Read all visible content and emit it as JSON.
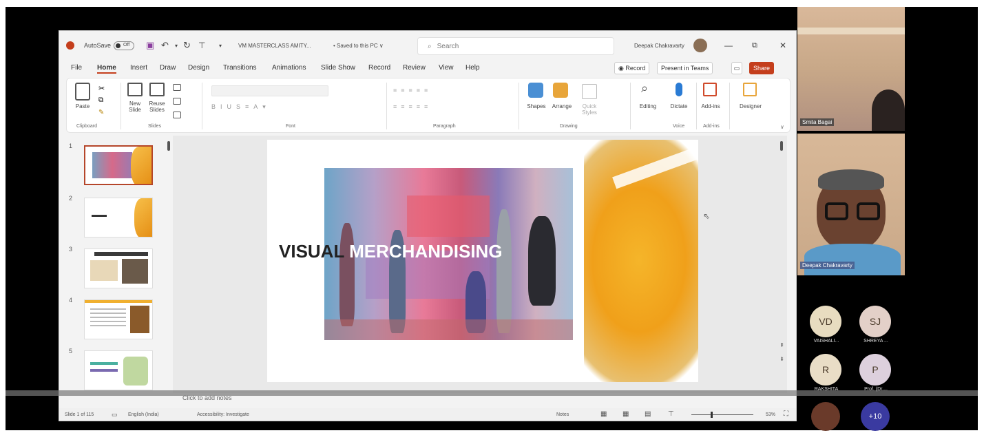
{
  "window": {
    "autosave_label": "AutoSave",
    "autosave_state": "Off",
    "doc_title": "VM MASTERCLASS AMITY...",
    "save_status": "• Saved to this PC ∨",
    "search_placeholder": "Search",
    "user_name": "Deepak Chakravarty"
  },
  "menu": [
    "File",
    "Home",
    "Insert",
    "Draw",
    "Design",
    "Transitions",
    "Animations",
    "Slide Show",
    "Record",
    "Review",
    "View",
    "Help"
  ],
  "menu_active": "Home",
  "menu_buttons": {
    "record": "◉ Record",
    "present_teams": "Present in Teams",
    "share": "Share"
  },
  "ribbon": {
    "paste": "Paste",
    "new_slide": "New Slide",
    "reuse_slides": "Reuse Slides",
    "shapes": "Shapes",
    "arrange": "Arrange",
    "quick_styles": "Quick Styles",
    "editing": "Editing",
    "dictate": "Dictate",
    "addins": "Add-ins",
    "designer": "Designer",
    "groups": {
      "clipboard": "Clipboard",
      "slides": "Slides",
      "font": "Font",
      "paragraph": "Paragraph",
      "drawing": "Drawing",
      "voice": "Voice",
      "addins": "Add-ins"
    }
  },
  "thumbnails": [
    {
      "num": "1"
    },
    {
      "num": "2"
    },
    {
      "num": "3"
    },
    {
      "num": "4"
    },
    {
      "num": "5"
    }
  ],
  "slide": {
    "title_word1": "VISUAL",
    "title_word2": "MERCHANDISING"
  },
  "notes_placeholder": "Click to add notes",
  "status": {
    "slide_count": "Slide 1 of 115",
    "language": "English (India)",
    "accessibility": "Accessibility: Investigate",
    "notes": "Notes",
    "zoom": "53%"
  },
  "participants": {
    "video": [
      {
        "name": "Smita Bagai"
      },
      {
        "name": "Deepak Chakravarty"
      }
    ],
    "avatars": [
      {
        "initials": "VD",
        "name": "VAISHALI...",
        "color": "#e8dcc0"
      },
      {
        "initials": "SJ",
        "name": "SHREYA ...",
        "color": "#e3d0c8"
      },
      {
        "initials": "R",
        "name": "RAKSHITA",
        "color": "#e9ddc6"
      },
      {
        "initials": "P",
        "name": "Prof. (Dr....",
        "color": "#ddd0dd"
      }
    ],
    "more": "+10"
  }
}
